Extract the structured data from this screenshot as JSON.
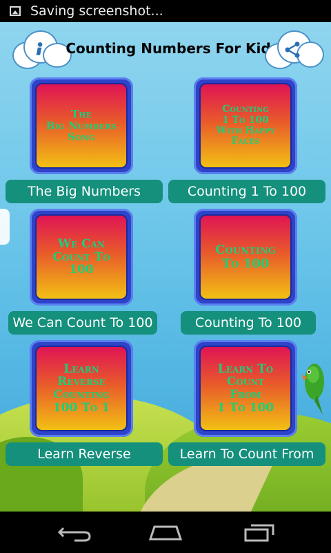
{
  "status_bar": {
    "text": "Saving screenshot...",
    "icon": "picture-icon"
  },
  "header": {
    "title": "Counting Numbers For Kids",
    "info_icon": "info-icon",
    "share_icon": "share-icon"
  },
  "tiles": [
    {
      "art": "The\nBig Numbers\nSong",
      "label": "The Big Numbers"
    },
    {
      "art": "Counting\n1 To 100\nWith Happy\nFaces",
      "label": "Counting 1 To 100"
    },
    {
      "art": "We Can\nCount To\n100",
      "label": "We Can Count To 100"
    },
    {
      "art": "Counting\nTo 100",
      "label": "Counting To 100"
    },
    {
      "art": "Learn\nReverse\nCounting\n100 To 1",
      "label": "Learn Reverse"
    },
    {
      "art": "Learn To\nCount\nFrom\n1 To 100",
      "label": "Learn To Count From"
    }
  ],
  "nav": {
    "back": "back-icon",
    "home": "home-icon",
    "recents": "recents-icon"
  }
}
